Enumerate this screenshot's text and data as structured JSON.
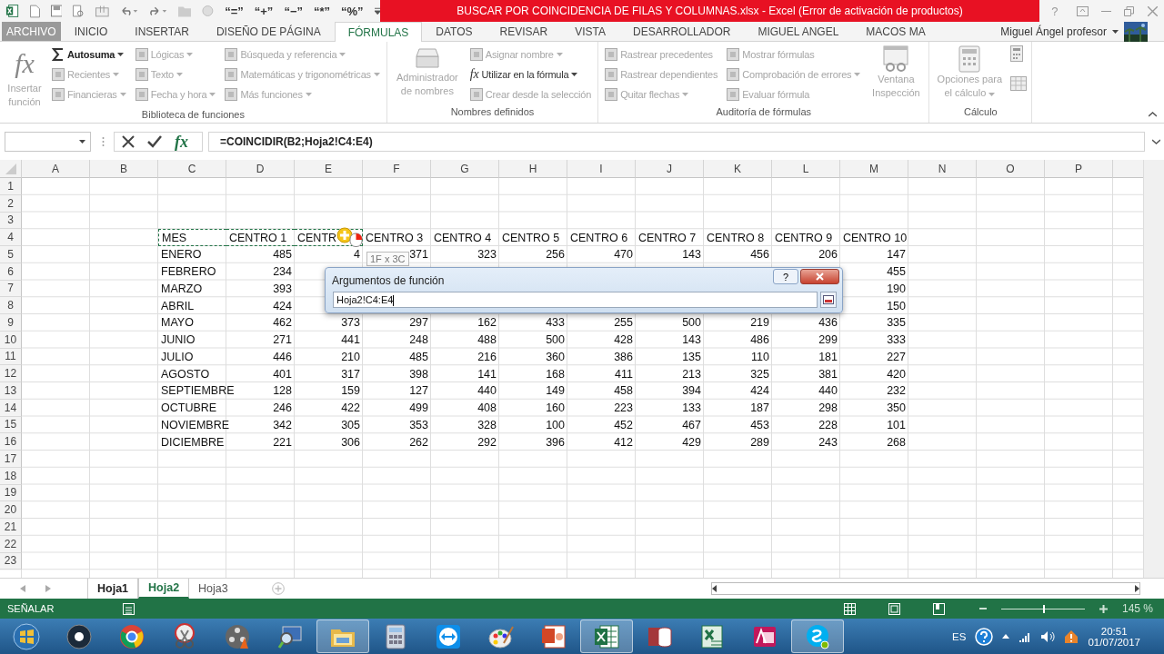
{
  "window": {
    "title": "BUSCAR POR COINCIDENCIA DE FILAS Y COLUMNAS.xlsx -  Excel (Error de activación de productos)",
    "help": "?"
  },
  "quick_access": {
    "symbols": [
      "“=”",
      "“+”",
      "“−”",
      "“*”",
      "“%”"
    ]
  },
  "tabs": [
    {
      "label": "ARCHIVO",
      "kind": "file",
      "selected": false
    },
    {
      "label": "INICIO",
      "kind": "tab",
      "selected": false
    },
    {
      "label": "INSERTAR",
      "kind": "tab",
      "selected": false
    },
    {
      "label": "DISEÑO DE PÁGINA",
      "kind": "tab",
      "selected": false
    },
    {
      "label": "FÓRMULAS",
      "kind": "tab",
      "selected": true
    },
    {
      "label": "DATOS",
      "kind": "tab",
      "selected": false
    },
    {
      "label": "REVISAR",
      "kind": "tab",
      "selected": false
    },
    {
      "label": "VISTA",
      "kind": "tab",
      "selected": false
    },
    {
      "label": "DESARROLLADOR",
      "kind": "tab",
      "selected": false
    },
    {
      "label": "MIGUEL ANGEL",
      "kind": "tab",
      "selected": false
    },
    {
      "label": "MACOS MA",
      "kind": "tab",
      "selected": false
    }
  ],
  "user": {
    "name": "Miguel Ángel profesor"
  },
  "ribbon": {
    "groups": [
      {
        "label": "Biblioteca de funciones",
        "columns": [
          [
            {
              "label": "Insertar función",
              "kind": "function-large",
              "icon_text": "fx",
              "disabled": true,
              "dropdown": false
            }
          ],
          [
            {
              "label": "Autosuma",
              "kind": "sum",
              "disabled": false,
              "dropdown": true
            },
            {
              "label": "Recientes",
              "kind": "small",
              "disabled": true,
              "dropdown": true
            },
            {
              "label": "Financieras",
              "kind": "small",
              "disabled": true,
              "dropdown": true
            }
          ],
          [
            {
              "label": "Lógicas",
              "kind": "small",
              "disabled": true,
              "dropdown": true
            },
            {
              "label": "Texto",
              "kind": "small",
              "disabled": true,
              "dropdown": true
            },
            {
              "label": "Fecha y hora",
              "kind": "small",
              "disabled": true,
              "dropdown": true
            }
          ],
          [
            {
              "label": "Búsqueda y referencia",
              "kind": "small",
              "disabled": true,
              "dropdown": true
            },
            {
              "label": "Matemáticas y trigonométricas",
              "kind": "small",
              "disabled": true,
              "dropdown": true
            },
            {
              "label": "Más funciones",
              "kind": "small",
              "disabled": true,
              "dropdown": true
            }
          ]
        ]
      },
      {
        "label": "Nombres definidos",
        "columns": [
          [
            {
              "label": "Administrador de nombres",
              "kind": "names-large",
              "disabled": true,
              "dropdown": false
            }
          ],
          [
            {
              "label": "Asignar nombre",
              "kind": "small",
              "disabled": true,
              "dropdown": true
            },
            {
              "label": "Utilizar en la fórmula",
              "kind": "function-small",
              "icon_text": "fx",
              "disabled": false,
              "dropdown": true
            },
            {
              "label": "Crear desde la selección",
              "kind": "small",
              "disabled": true,
              "dropdown": false
            }
          ]
        ]
      },
      {
        "label": "Auditoría de fórmulas",
        "columns": [
          [
            {
              "label": "Rastrear precedentes",
              "kind": "small",
              "disabled": true,
              "dropdown": false
            },
            {
              "label": "Rastrear dependientes",
              "kind": "small",
              "disabled": true,
              "dropdown": false
            },
            {
              "label": "Quitar flechas",
              "kind": "small",
              "disabled": true,
              "dropdown": true
            }
          ],
          [
            {
              "label": "Mostrar fórmulas",
              "kind": "small",
              "disabled": true,
              "dropdown": false
            },
            {
              "label": "Comprobación de errores",
              "kind": "small",
              "disabled": true,
              "dropdown": true
            },
            {
              "label": "Evaluar fórmula",
              "kind": "small",
              "disabled": true,
              "dropdown": false
            }
          ],
          [
            {
              "label": "Ventana Inspección",
              "kind": "watch-large",
              "disabled": true,
              "dropdown": false
            }
          ]
        ]
      },
      {
        "label": "Cálculo",
        "columns": [
          [
            {
              "label": "Opciones para el cálculo",
              "kind": "calc-large",
              "disabled": true,
              "dropdown": true
            }
          ],
          [
            {
              "kind": "calc-icon",
              "disabled": true
            }
          ]
        ]
      }
    ]
  },
  "formula_bar": {
    "function_symbol": "fx",
    "formula": "=COINCIDIR(B2;Hoja2!C4:E4)"
  },
  "sheet": {
    "columns": [
      "A",
      "B",
      "C",
      "D",
      "E",
      "F",
      "G",
      "H",
      "I",
      "J",
      "K",
      "L",
      "M",
      "N",
      "O",
      "P"
    ],
    "rows": [
      {
        "number": "1"
      },
      {
        "number": "2"
      },
      {
        "number": "3"
      },
      {
        "number": "4",
        "kind": "header",
        "cells": [
          null,
          null,
          {
            "text": "MES",
            "referenced": true
          },
          {
            "text": "CENTRO 1",
            "referenced": true
          },
          {
            "text": "CENTR",
            "referenced": true
          },
          "CENTRO 3",
          "CENTRO 4",
          "CENTRO 5",
          "CENTRO 6",
          "CENTRO 7",
          "CENTRO 8",
          "CENTRO 9",
          "CENTRO 10"
        ]
      },
      {
        "number": "5",
        "kind": "data",
        "cells": [
          null,
          null,
          "ENERO",
          "485",
          "4",
          "371",
          "323",
          "256",
          "470",
          "143",
          "456",
          "206",
          "147"
        ]
      },
      {
        "number": "6",
        "kind": "data",
        "cells": [
          null,
          null,
          "FEBRERO",
          "234",
          null,
          null,
          null,
          null,
          null,
          null,
          null,
          null,
          "455"
        ]
      },
      {
        "number": "7",
        "kind": "data",
        "cells": [
          null,
          null,
          "MARZO",
          "393",
          null,
          null,
          null,
          null,
          null,
          null,
          null,
          null,
          "190"
        ]
      },
      {
        "number": "8",
        "kind": "data",
        "cells": [
          null,
          null,
          "ABRIL",
          "424",
          null,
          null,
          null,
          null,
          null,
          null,
          null,
          null,
          "150"
        ]
      },
      {
        "number": "9",
        "kind": "data",
        "cells": [
          null,
          null,
          "MAYO",
          "462",
          "373",
          "297",
          "162",
          "433",
          "255",
          "500",
          "219",
          "436",
          "335"
        ]
      },
      {
        "number": "10",
        "kind": "data",
        "cells": [
          null,
          null,
          "JUNIO",
          "271",
          "441",
          "248",
          "488",
          "500",
          "428",
          "143",
          "486",
          "299",
          "333"
        ]
      },
      {
        "number": "11",
        "kind": "data",
        "cells": [
          null,
          null,
          "JULIO",
          "446",
          "210",
          "485",
          "216",
          "360",
          "386",
          "135",
          "110",
          "181",
          "227"
        ]
      },
      {
        "number": "12",
        "kind": "data",
        "cells": [
          null,
          null,
          "AGOSTO",
          "401",
          "317",
          "398",
          "141",
          "168",
          "411",
          "213",
          "325",
          "381",
          "420"
        ]
      },
      {
        "number": "13",
        "kind": "data",
        "cells": [
          null,
          null,
          "SEPTIEMBRE",
          "128",
          "159",
          "127",
          "440",
          "149",
          "458",
          "394",
          "424",
          "440",
          "232"
        ]
      },
      {
        "number": "14",
        "kind": "data",
        "cells": [
          null,
          null,
          "OCTUBRE",
          "246",
          "422",
          "499",
          "408",
          "160",
          "223",
          "133",
          "187",
          "298",
          "350"
        ]
      },
      {
        "number": "15",
        "kind": "data",
        "cells": [
          null,
          null,
          "NOVIEMBRE",
          "342",
          "305",
          "353",
          "328",
          "100",
          "452",
          "467",
          "453",
          "228",
          "101"
        ]
      },
      {
        "number": "16",
        "kind": "data",
        "cells": [
          null,
          null,
          "DICIEMBRE",
          "221",
          "306",
          "262",
          "292",
          "396",
          "412",
          "429",
          "289",
          "243",
          "268"
        ]
      },
      {
        "number": "17"
      },
      {
        "number": "18"
      },
      {
        "number": "19"
      },
      {
        "number": "20"
      },
      {
        "number": "21"
      },
      {
        "number": "22"
      },
      {
        "number": "23"
      }
    ]
  },
  "range_tooltip": "1F x 3C",
  "dialog": {
    "title": "Argumentos de función",
    "help": "?",
    "value": "Hoja2!C4:E4"
  },
  "sheet_tabs": [
    {
      "label": "Hoja1",
      "highlighted": true,
      "selected": false
    },
    {
      "label": "Hoja2",
      "highlighted": true,
      "selected": true
    },
    {
      "label": "Hoja3",
      "highlighted": false,
      "selected": false
    }
  ],
  "status_bar": {
    "mode": "SEÑALAR",
    "zoom": "145 %",
    "zoom_slider": {
      "level": 0.5
    }
  },
  "taskbar": {
    "apps": [
      {
        "kind": "start",
        "active": false
      },
      {
        "kind": "disc",
        "active": false
      },
      {
        "kind": "ring",
        "active": false
      },
      {
        "kind": "scissors",
        "active": false
      },
      {
        "kind": "reel",
        "active": false
      },
      {
        "kind": "monitor",
        "active": false
      },
      {
        "kind": "folder",
        "active": true
      },
      {
        "kind": "calculator",
        "active": false
      },
      {
        "kind": "arrows",
        "active": false
      },
      {
        "kind": "palette",
        "active": false
      },
      {
        "kind": "slides",
        "active": false
      },
      {
        "kind": "sheet",
        "active": true
      },
      {
        "kind": "database",
        "active": false
      },
      {
        "kind": "sheet2",
        "active": false
      },
      {
        "kind": "form",
        "active": false
      },
      {
        "kind": "bubble",
        "active": true
      }
    ],
    "language": "ES",
    "time": "20:51",
    "date": "01/07/2017"
  }
}
